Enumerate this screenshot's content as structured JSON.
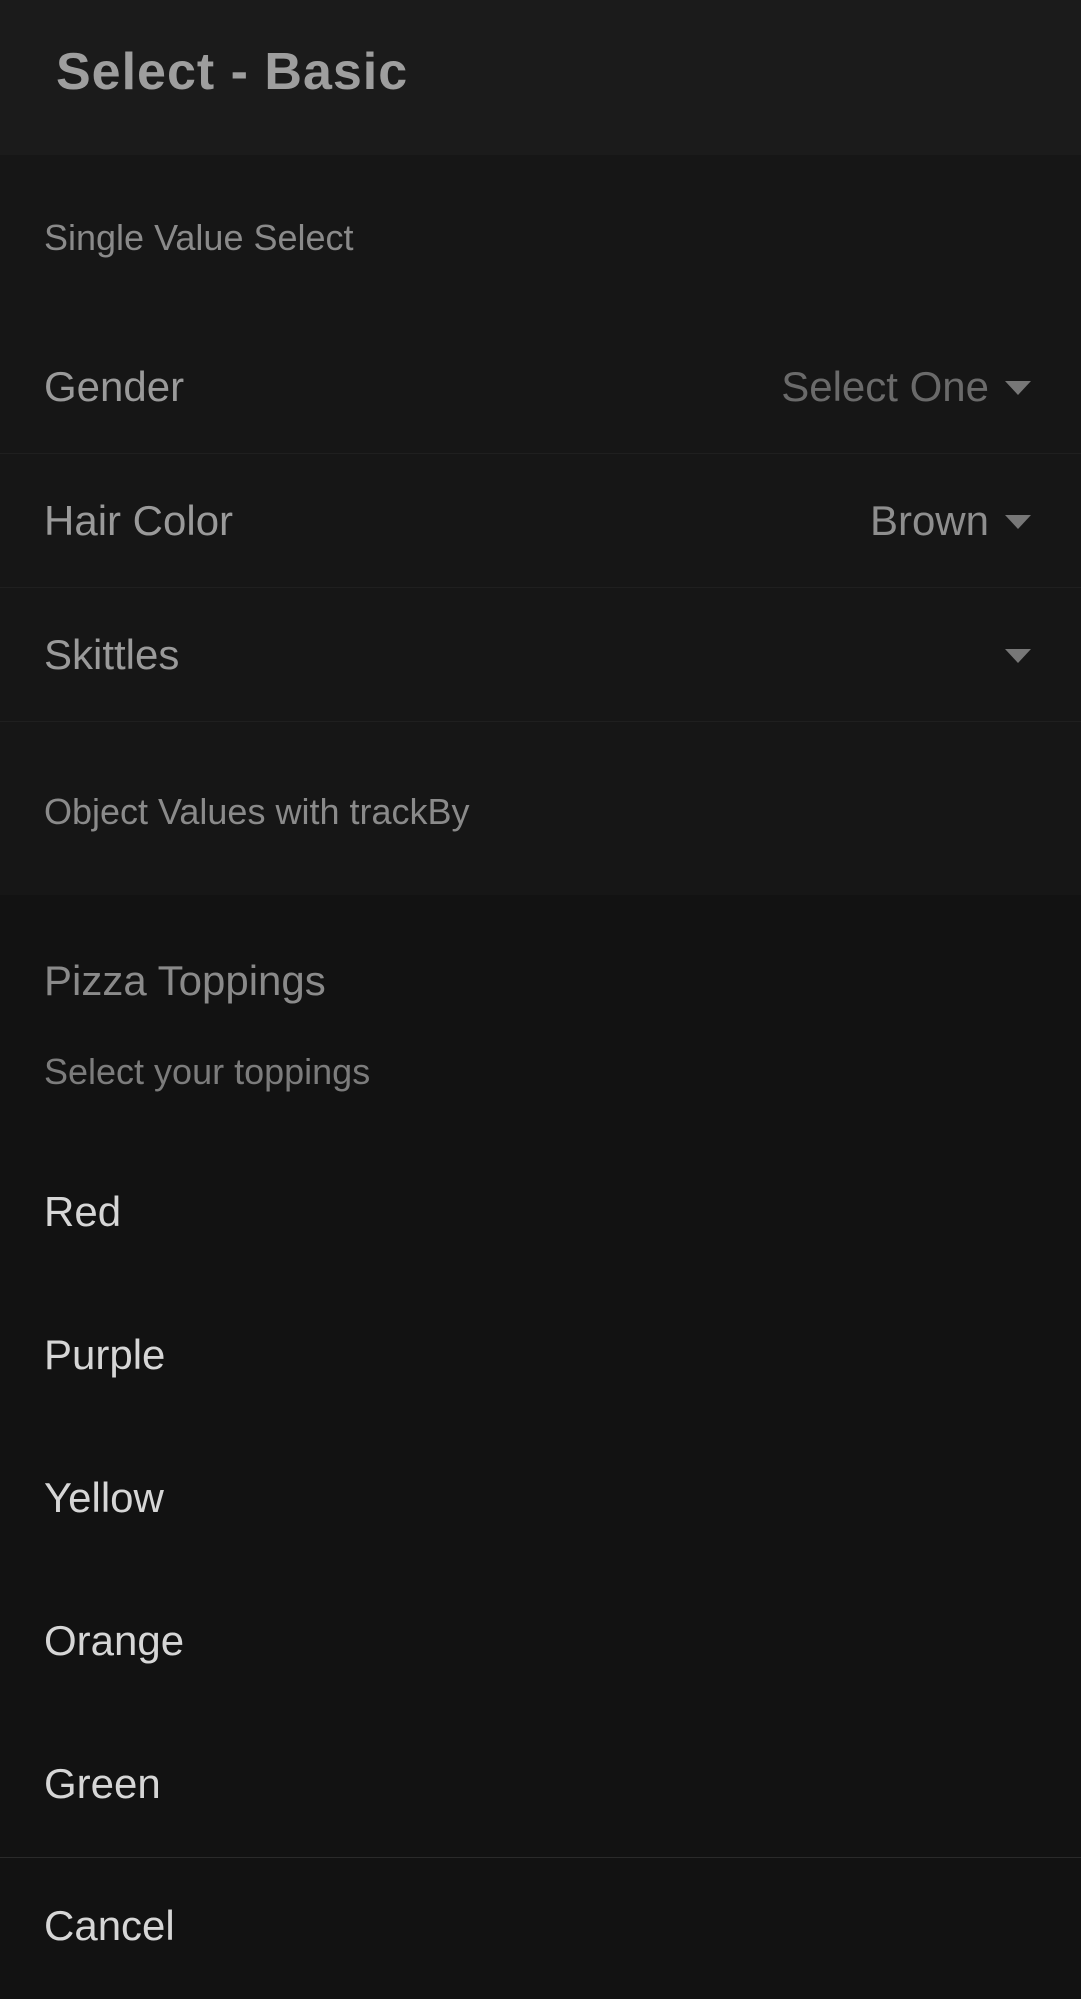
{
  "toolbar": {
    "title": "Select - Basic"
  },
  "section1": {
    "header": "Single Value Select",
    "items": [
      {
        "label": "Gender",
        "value": "Select One"
      },
      {
        "label": "Hair Color",
        "value": "Brown"
      },
      {
        "label": "Skittles",
        "value": ""
      }
    ]
  },
  "section2": {
    "header": "Object Values with trackBy"
  },
  "action_sheet": {
    "title": "Pizza Toppings",
    "subtitle": "Select your toppings",
    "options": [
      "Red",
      "Purple",
      "Yellow",
      "Orange",
      "Green"
    ],
    "cancel_label": "Cancel"
  },
  "icons": {
    "select_caret": "caret-down-icon"
  },
  "colors": {
    "background": "#121212",
    "toolbar": "#1b1b1b",
    "text_primary": "#d6d6d6",
    "text_secondary": "#8a8a8a"
  }
}
